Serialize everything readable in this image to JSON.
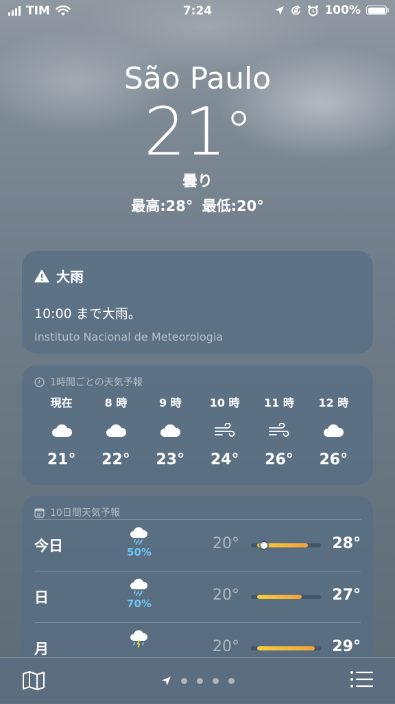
{
  "status_bar": {
    "carrier": "TIM",
    "time": "7:24",
    "battery": "100%",
    "icons": [
      "signal-bars-icon",
      "wifi-icon",
      "location-arrow-icon",
      "orientation-lock-icon",
      "alarm-clock-icon",
      "battery-icon"
    ]
  },
  "header": {
    "city": "São Paulo",
    "temperature": "21",
    "degree_symbol": "°",
    "condition": "曇り",
    "high_low": "最高:28° 最低:20°"
  },
  "alert": {
    "icon": "warning-triangle-icon",
    "title": "大雨",
    "message": "10:00 まで大雨。",
    "source": "Instituto Nacional de Meteorologia"
  },
  "hourly": {
    "icon": "clock-icon",
    "title": "1時間ごとの天気予報",
    "items": [
      {
        "label": "現在",
        "icon": "cloud-icon",
        "temp": "21°"
      },
      {
        "label": "8 時",
        "icon": "cloud-icon",
        "temp": "22°"
      },
      {
        "label": "9 時",
        "icon": "cloud-icon",
        "temp": "23°"
      },
      {
        "label": "10 時",
        "icon": "wind-icon",
        "temp": "24°"
      },
      {
        "label": "11 時",
        "icon": "wind-icon",
        "temp": "26°"
      },
      {
        "label": "12 時",
        "icon": "cloud-icon",
        "temp": "26°"
      }
    ]
  },
  "daily": {
    "icon": "calendar-icon",
    "title": "10日間天気予報",
    "range_min": 19,
    "range_max": 30,
    "items": [
      {
        "day": "今日",
        "icon": "cloud-rain-icon",
        "pop": "50%",
        "low": "20°",
        "high": "28°",
        "low_value": 20,
        "high_value": 28,
        "current_value": 21
      },
      {
        "day": "日",
        "icon": "cloud-rain-icon",
        "pop": "70%",
        "low": "20°",
        "high": "27°",
        "low_value": 20,
        "high_value": 27
      },
      {
        "day": "月",
        "icon": "cloud-bolt-rain-icon",
        "pop": "",
        "low": "20°",
        "high": "29°",
        "low_value": 20,
        "high_value": 29
      }
    ]
  },
  "toolbar": {
    "map_icon": "map-icon",
    "location_icon": "location-arrow-icon",
    "page_count": 5,
    "list_icon": "list-icon"
  },
  "colors": {
    "precip_blue": "#6ec6f5",
    "range_bar_start": "#f6cf3a",
    "range_bar_end": "#f0a23a"
  }
}
